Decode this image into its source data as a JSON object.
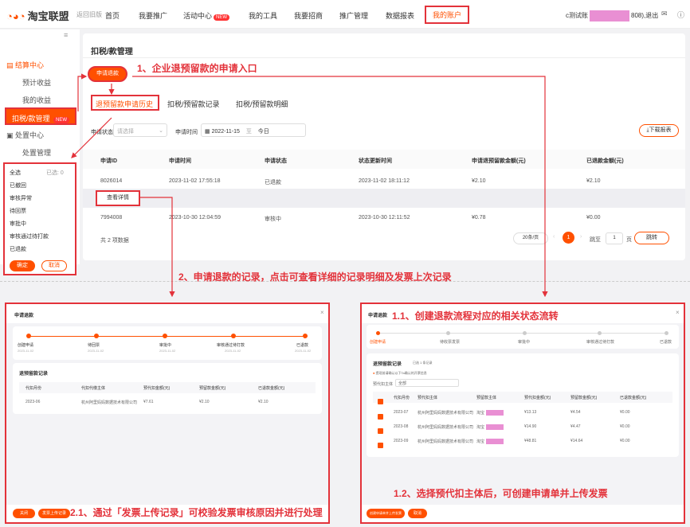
{
  "topbar": {
    "logo": "淘宝联盟",
    "old": "返回旧版",
    "nav": [
      "首页",
      "我要推广",
      "活动中心",
      "我的工具",
      "我要招商",
      "推广管理",
      "数据报表"
    ],
    "new_badge": "NEW",
    "active": "我的账户",
    "user_prefix": "c测试账",
    "user_suffix": "808),退出"
  },
  "sidebar": {
    "settle": "结算中心",
    "items": [
      "预计收益",
      "我的收益"
    ],
    "tax": "扣税/款管理",
    "tax_badge": "NEW",
    "handle": "处置中心",
    "handle_item": "处置管理"
  },
  "panel": {
    "title": "扣税/款管理",
    "apply_btn": "申请退款",
    "tabs": [
      "退预留款申请历史",
      "扣税/预留款记录",
      "扣税/预留款明细"
    ],
    "filter": {
      "status_label": "申请状态",
      "status_placeholder": "请选择",
      "time_label": "申请时间",
      "date": "2022-11-15",
      "to": "至",
      "today": "今日",
      "download": "下载报表"
    },
    "headers": [
      "申请ID",
      "申请时间",
      "申请状态",
      "状态更新时间",
      "申请退预留款金额(元)",
      "已退款金额(元)"
    ],
    "rows": [
      [
        "8026014",
        "2023-11-02 17:55:18",
        "已退款",
        "2023-11-02 18:11:12",
        "¥2.10",
        "¥2.10"
      ],
      [
        "7994008",
        "2023-10-30 12:04:59",
        "审核中",
        "2023-10-30 12:11:52",
        "¥0.78",
        "¥0.00"
      ]
    ],
    "detail_btn": "查看详情",
    "total": "共 2 项数据",
    "per_page": "20条/页",
    "page": "1",
    "goto": "跳至",
    "page_unit": "页",
    "jump": "跳转"
  },
  "dropdown": {
    "all": "全选",
    "selected": "已选: 0",
    "options": [
      "已撤回",
      "审核异常",
      "待回票",
      "审批中",
      "审核通过待打款",
      "已退款"
    ],
    "ok": "确定",
    "cancel": "取消"
  },
  "annotations": {
    "a1": "1、企业退预留款的申请入口",
    "a2": "2、申请退款的记录，点击可查看详细的记录明细及发票上次记录",
    "a11": "1.1、创建退款流程对应的相关状态流转",
    "a12": "1.2、选择预代扣主体后，可创建申请单并上传发票",
    "a21": "2.1、通过「发票上传记录」可校验发票审核原因并进行处理"
  },
  "modal_left": {
    "title": "申请退款",
    "steps": [
      "创建申请",
      "待回票",
      "审批中",
      "审核通过待打款",
      "已退款"
    ],
    "step_dates": [
      "2023-11-02",
      "2023-11-02",
      "2023-11-02",
      "2023-11-02",
      "2023-11-02"
    ],
    "section": "退预留款记录",
    "headers": [
      "代扣月份",
      "代扣代缴主体",
      "预代扣金额(元)",
      "预留款金额(元)",
      "已退款金额(元)"
    ],
    "row": [
      "2023-06",
      "杭州阿里妈妈数据技术有限公司",
      "¥7.61",
      "¥2.10",
      "¥2.10"
    ],
    "btn_close": "关闭",
    "btn_upload": "发票上传记录"
  },
  "modal_right": {
    "title": "申请退款",
    "steps": [
      "创建申请",
      "待收票发票",
      "审批中",
      "审核通过待打款",
      "已退款"
    ],
    "section": "退预留款记录",
    "section_sub": "已选 1 条记录",
    "notice": "提现前请确认以下Ta确认的开票信息",
    "entity_label": "预代扣主体",
    "entity_value": "全部",
    "headers": [
      "代扣月份",
      "预代扣主体",
      "预留款主体",
      "预代扣金额(元)",
      "预留款金额(元)",
      "已退款金额(元)"
    ],
    "rows": [
      [
        "2023-07",
        "杭州阿里妈妈数据技术有限公司",
        "淘宝",
        "¥13.13",
        "¥4.54",
        "¥0.00"
      ],
      [
        "2023-08",
        "杭州阿里妈妈数据技术有限公司",
        "淘宝",
        "¥14.90",
        "¥4.47",
        "¥0.00"
      ],
      [
        "2023-09",
        "杭州阿里妈妈数据技术有限公司",
        "淘宝",
        "¥48.81",
        "¥14.64",
        "¥0.00"
      ]
    ],
    "btn_submit": "创建申请单并上传发票",
    "btn_cancel": "取消"
  },
  "colors": {
    "accent": "#ff5000",
    "annot": "#e3323a",
    "pink": "#e98fd3"
  }
}
